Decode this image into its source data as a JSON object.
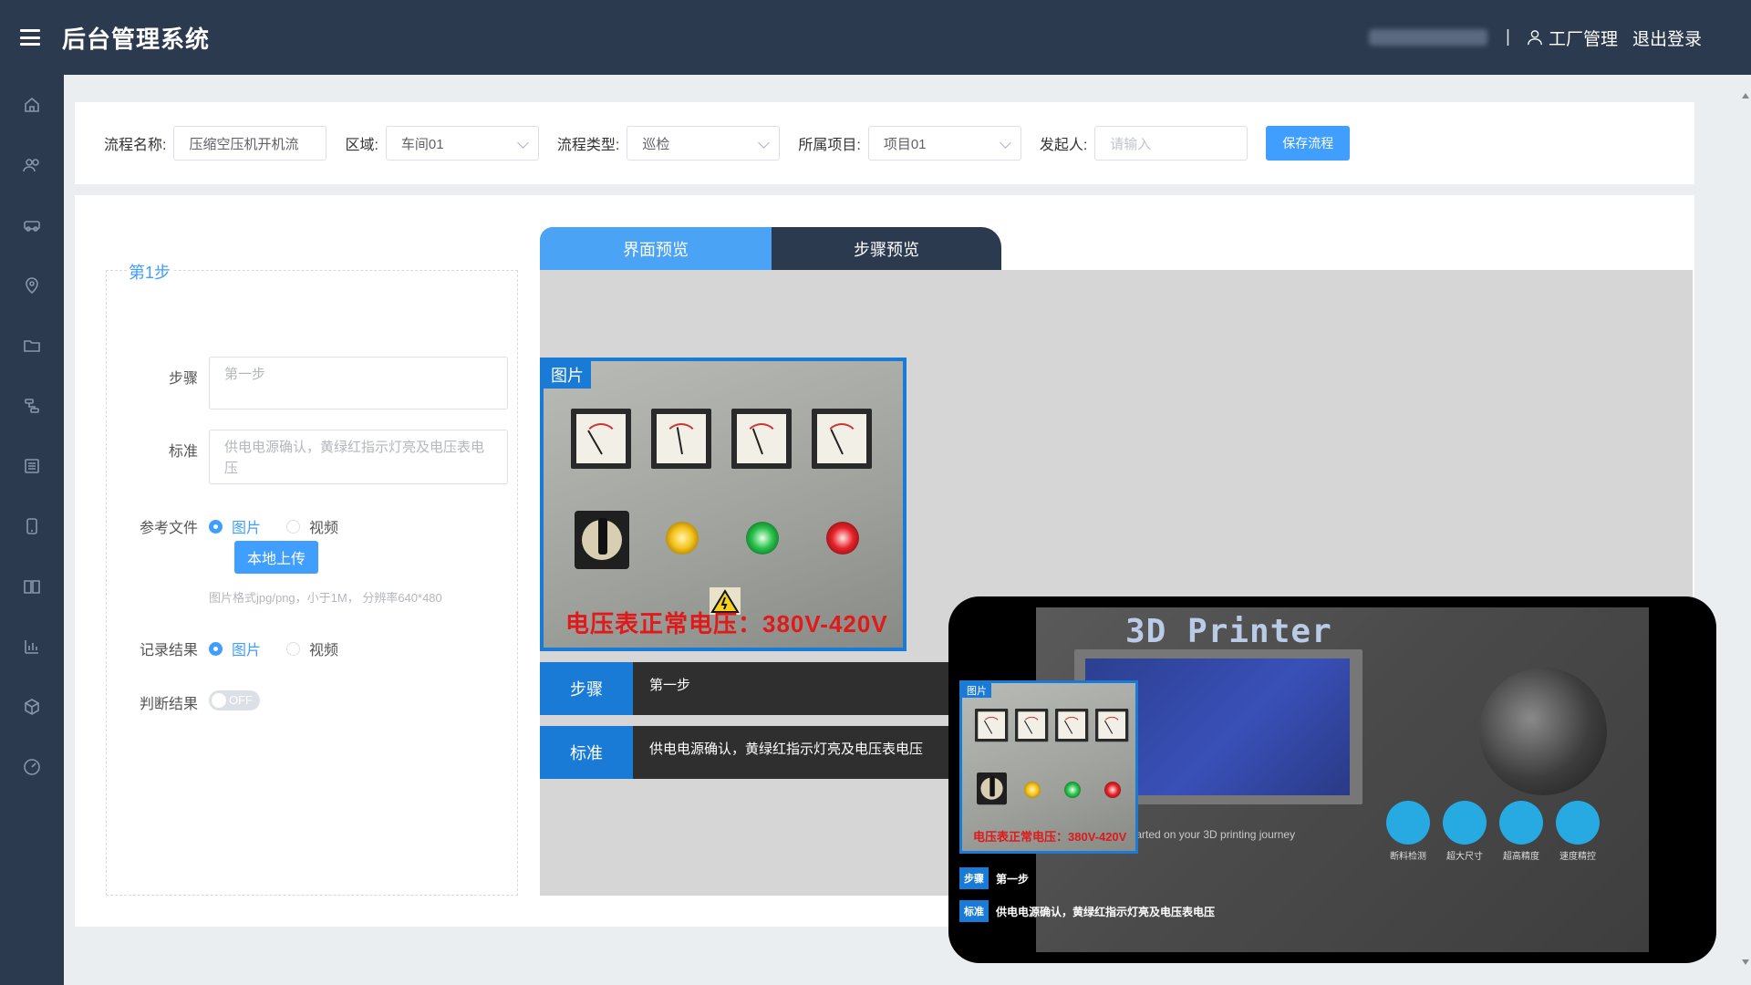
{
  "header": {
    "title": "后台管理系统",
    "separator": "|",
    "role": "工厂管理",
    "logout": "退出登录"
  },
  "sidebar": {
    "items": [
      "home-icon",
      "users-icon",
      "vehicle-icon",
      "location-icon",
      "folder-icon",
      "flow-icon",
      "list-icon",
      "device-icon",
      "book-icon",
      "chart-icon",
      "box-icon",
      "gauge-icon"
    ]
  },
  "form": {
    "name_label": "流程名称:",
    "name_value": "压缩空压机开机流",
    "area_label": "区域:",
    "area_value": "车间01",
    "type_label": "流程类型:",
    "type_value": "巡检",
    "project_label": "所属项目:",
    "project_value": "项目01",
    "initiator_label": "发起人:",
    "initiator_placeholder": "请输入",
    "save_label": "保存流程"
  },
  "step": {
    "title": "第1步",
    "step_label": "步骤",
    "step_placeholder": "第一步",
    "standard_label": "标准",
    "standard_placeholder": "供电电源确认，黄绿红指示灯亮及电压表电压",
    "ref_label": "参考文件",
    "ref_opt_image": "图片",
    "ref_opt_video": "视频",
    "upload_label": "本地上传",
    "upload_hint": "图片格式jpg/png，小于1M， 分辨率640*480",
    "record_label": "记录结果",
    "record_opt_image": "图片",
    "record_opt_video": "视频",
    "judge_label": "判断结果",
    "judge_toggle": "OFF"
  },
  "preview": {
    "tab_ui": "界面预览",
    "tab_steps": "步骤预览",
    "pic_badge": "图片",
    "volt_text": "电压表正常电压：380V-420V",
    "step_key": "步骤",
    "step_val": "第一步",
    "std_key": "标准",
    "std_val": "供电电源确认，黄绿红指示灯亮及电压表电压"
  },
  "phone": {
    "printer_title": "3D Printer",
    "journey_text": "tarted on your 3D printing journey",
    "features": [
      "断料检测",
      "超大尺寸",
      "超高精度",
      "速度精控"
    ],
    "pic_badge": "图片",
    "volt_text": "电压表正常电压：380V-420V",
    "step_key": "步骤",
    "step_val": "第一步",
    "std_key": "标准",
    "std_val": "供电电源确认，黄绿红指示灯亮及电压表电压"
  },
  "colors": {
    "primary": "#409eff",
    "nav_bg": "#2b3a4f",
    "accent_blue": "#1a7bd6",
    "warning_red": "#e0191a"
  }
}
